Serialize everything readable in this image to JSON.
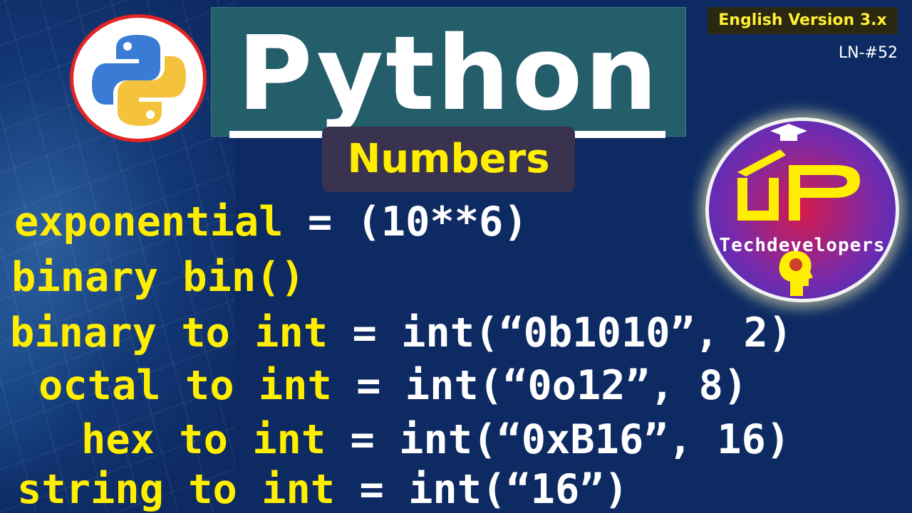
{
  "title": "Python",
  "subtitle": "Numbers",
  "version_badge": "English Version 3.x",
  "lesson_number": "LN-#52",
  "brand_name": "Techdevelopers",
  "colors": {
    "background": "#0d2a63",
    "title_box": "#245e6b",
    "subtitle_box": "#3a3350",
    "keyword_yellow": "#ffee00",
    "code_white": "#ffffff"
  },
  "icons": {
    "python_logo": "python-logo-icon",
    "brand_logo": "up-techdevelopers-logo-icon"
  },
  "code_lines": [
    {
      "keyword": "exponential",
      "expr": "= (10**6)"
    },
    {
      "keyword": "binary bin()",
      "expr": ""
    },
    {
      "keyword": "binary to int",
      "expr": "= int(“0b1010”, 2)"
    },
    {
      "keyword": "octal to int",
      "expr": "= int(“0o12”, 8)"
    },
    {
      "keyword": "hex to int",
      "expr": "= int(“0xB16”, 16)"
    },
    {
      "keyword": "string to int",
      "expr": "= int(“16”)"
    }
  ]
}
